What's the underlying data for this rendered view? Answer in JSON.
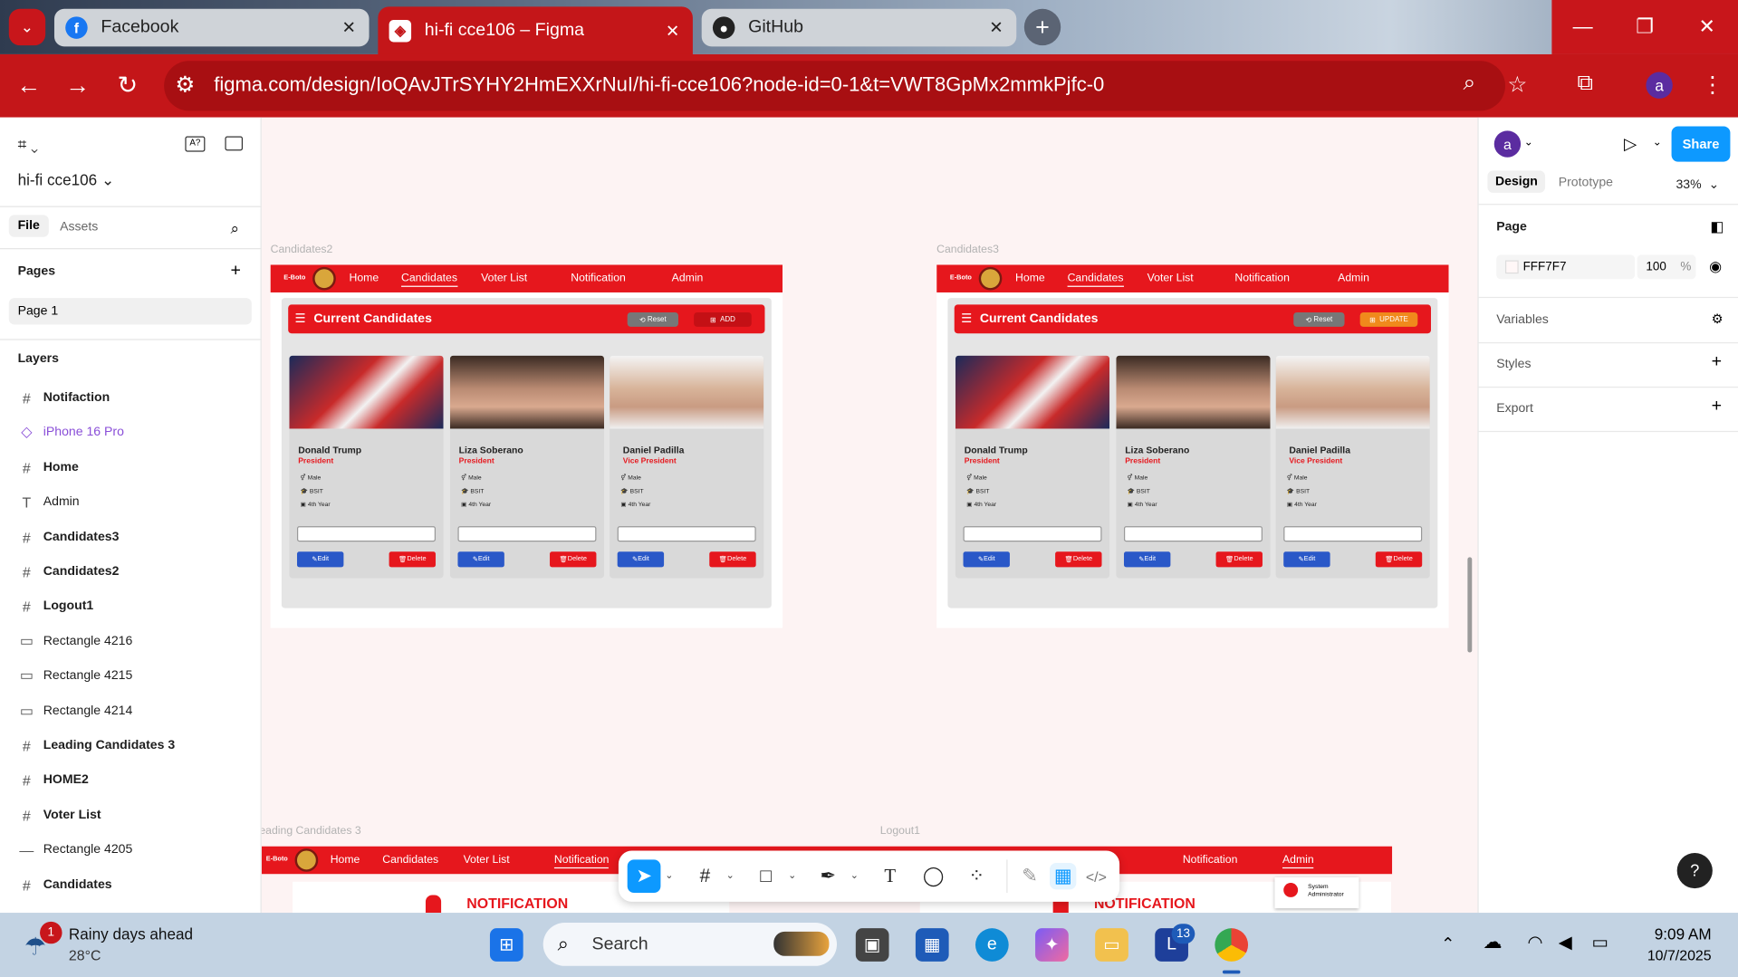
{
  "browser": {
    "tabs": [
      {
        "title": "Facebook",
        "icon": "facebook-icon"
      },
      {
        "title": "hi-fi cce106 – Figma",
        "icon": "figma-icon"
      },
      {
        "title": "GitHub",
        "icon": "github-icon"
      }
    ],
    "url": "figma.com/design/IoQAvJTrSYHY2HmEXXrNuI/hi-fi-cce106?node-id=0-1&t=VWT8GpMx2mmkPjfc-0",
    "profile_initial": "a"
  },
  "left_panel": {
    "file_name": "hi-fi cce106",
    "tabs": [
      "File",
      "Assets"
    ],
    "pages_label": "Pages",
    "page": "Page 1",
    "layers_label": "Layers",
    "layers": [
      {
        "name": "Notifaction",
        "icon": "frame-icon",
        "bold": true
      },
      {
        "name": "iPhone 16 Pro",
        "icon": "component-icon",
        "purple": true
      },
      {
        "name": "Home",
        "icon": "frame-icon",
        "bold": true
      },
      {
        "name": "Admin",
        "icon": "text-icon",
        "bold": false
      },
      {
        "name": "Candidates3",
        "icon": "frame-icon",
        "bold": true
      },
      {
        "name": "Candidates2",
        "icon": "frame-icon",
        "bold": true
      },
      {
        "name": "Logout1",
        "icon": "frame-icon",
        "bold": true
      },
      {
        "name": "Rectangle 4216",
        "icon": "rectangle-icon",
        "bold": false
      },
      {
        "name": "Rectangle 4215",
        "icon": "rectangle-icon",
        "bold": false
      },
      {
        "name": "Rectangle 4214",
        "icon": "rectangle-icon",
        "bold": false
      },
      {
        "name": " Leading Candidates 3",
        "icon": "frame-icon",
        "bold": true
      },
      {
        "name": "HOME2",
        "icon": "frame-icon",
        "bold": true
      },
      {
        "name": "Voter List",
        "icon": "frame-icon",
        "bold": true
      },
      {
        "name": "Rectangle 4205",
        "icon": "line-icon",
        "bold": false
      },
      {
        "name": "Candidates",
        "icon": "frame-icon",
        "bold": true
      }
    ]
  },
  "canvas": {
    "frame_labels": [
      "Candidates2",
      "Candidates3",
      "eading Candidates 3",
      "Logout1"
    ],
    "app": {
      "brand": "E-Boto",
      "nav": [
        "Home",
        "Candidates",
        "Voter List",
        "Notification",
        "Admin"
      ],
      "section_title": "Current Candidates",
      "reset": "Reset",
      "add": "ADD",
      "update": "UPDATE",
      "edit": "Edit",
      "delete": "Delete",
      "notification_title": "NOTIFICATION",
      "admin_name": "System Administrator",
      "candidates": [
        {
          "name": "Donald Trump",
          "position": "President",
          "gender": "Male",
          "course": "BSIT",
          "year": "4th Year"
        },
        {
          "name": "Liza Soberano",
          "position": "President",
          "gender": "Male",
          "course": "BSIT",
          "year": "4th Year"
        },
        {
          "name": "Daniel  Padilla",
          "position": "Vice President",
          "gender": "Male",
          "course": "BSIT",
          "year": "4th Year"
        }
      ]
    }
  },
  "right_panel": {
    "avatar": "a",
    "share": "Share",
    "tabs": [
      "Design",
      "Prototype"
    ],
    "zoom": "33%",
    "page_label": "Page",
    "bg_color": "FFF7F7",
    "opacity": "100",
    "opacity_unit": "%",
    "sections": [
      "Variables",
      "Styles",
      "Export"
    ]
  },
  "taskbar": {
    "weather_title": "Rainy days ahead",
    "weather_temp": "28°C",
    "weather_badge": "1",
    "search": "Search",
    "time": "9:09 AM",
    "date": "10/7/2025",
    "app_badge": "13"
  },
  "colors": {
    "chrome_red": "#c41619",
    "app_red": "#e6171d",
    "figma_blue": "#0d99ff",
    "edit_blue": "#2a58c8",
    "update_orange": "#f08a1c"
  }
}
